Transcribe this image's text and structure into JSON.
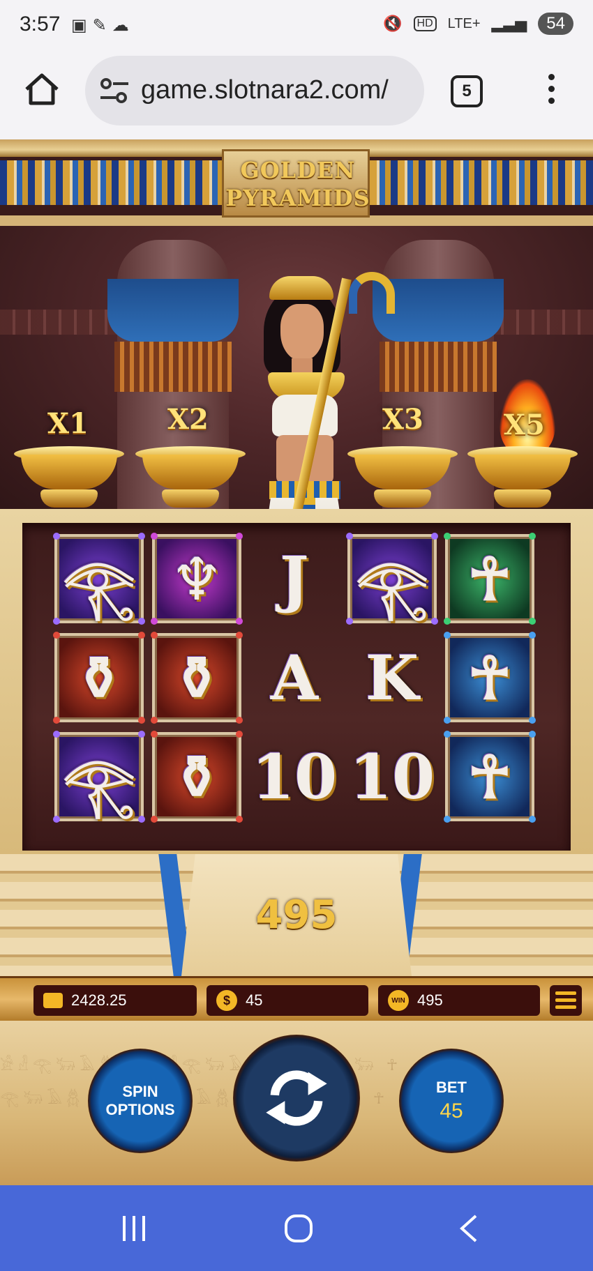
{
  "status_bar": {
    "time": "3:57",
    "network": "LTE+",
    "hd": "HD",
    "battery": "54"
  },
  "browser": {
    "url": "game.slotnara2.com/",
    "tab_count": "5"
  },
  "game": {
    "title_line1": "GOLDEN",
    "title_line2": "PYRAMIDS",
    "multipliers": [
      "X1",
      "X2",
      "X3",
      "X5"
    ],
    "reels": [
      [
        {
          "sym": "eye",
          "bg": "purple"
        },
        {
          "sym": "vase",
          "bg": "red"
        },
        {
          "sym": "eye",
          "bg": "purple"
        }
      ],
      [
        {
          "sym": "ankh-bowl",
          "bg": "violet"
        },
        {
          "sym": "vase",
          "bg": "red"
        },
        {
          "sym": "vase",
          "bg": "red"
        }
      ],
      [
        {
          "sym": "J",
          "bg": "none"
        },
        {
          "sym": "A",
          "bg": "none"
        },
        {
          "sym": "10",
          "bg": "none"
        }
      ],
      [
        {
          "sym": "eye",
          "bg": "purple"
        },
        {
          "sym": "K",
          "bg": "none"
        },
        {
          "sym": "10",
          "bg": "none"
        }
      ],
      [
        {
          "sym": "scarab-ankh",
          "bg": "green"
        },
        {
          "sym": "ankh",
          "bg": "blue"
        },
        {
          "sym": "ankh",
          "bg": "blue"
        }
      ]
    ],
    "win_display": "495"
  },
  "info": {
    "balance": "2428.25",
    "bet": "45",
    "win": "495",
    "coin_icon": "$",
    "win_icon": "WIN"
  },
  "controls": {
    "spin_options_line1": "SPIN",
    "spin_options_line2": "OPTIONS",
    "bet_label": "BET",
    "bet_value": "45"
  },
  "colors": {
    "accent_gold": "#f3b726",
    "panel_dark": "#3b0f0c",
    "button_blue": "#1664b4",
    "nav_blue": "#4868d8"
  }
}
